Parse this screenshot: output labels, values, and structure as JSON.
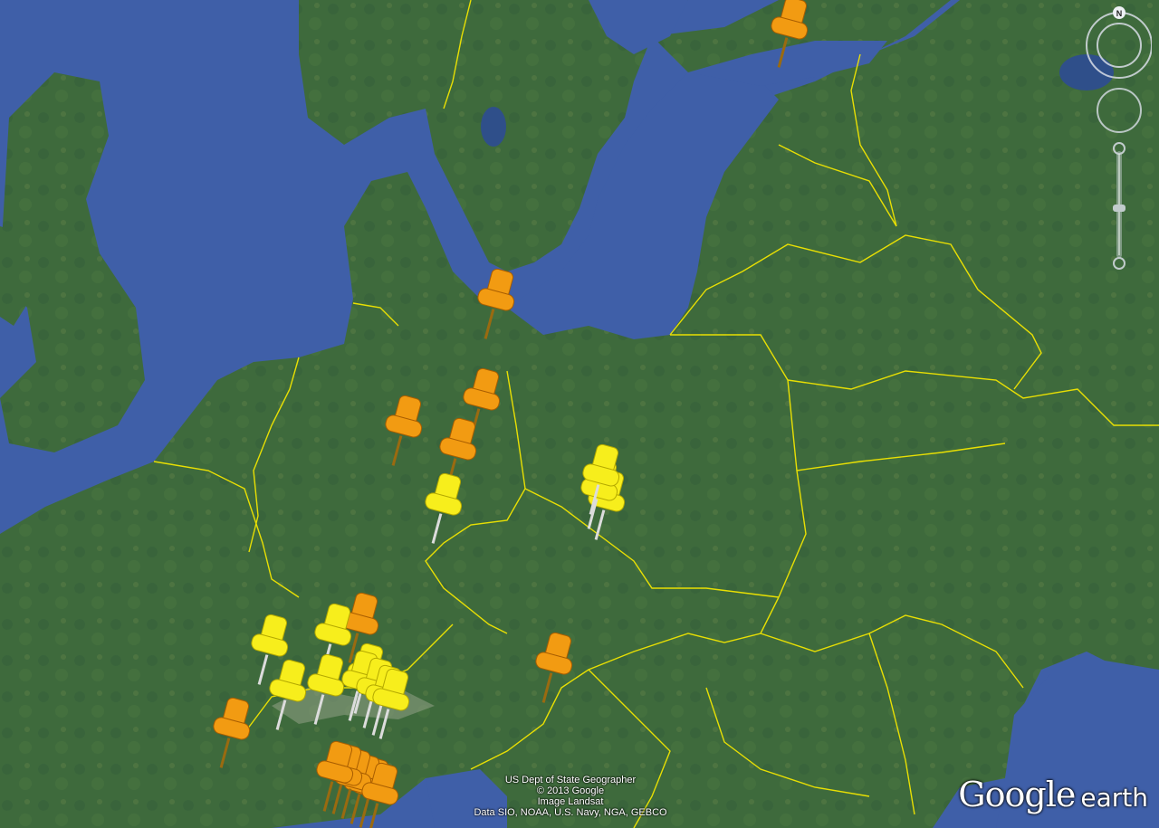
{
  "map": {
    "attribution_lines": [
      "US Dept of State Geographer",
      "© 2013 Google",
      "Image Landsat",
      "Data SIO, NOAA, U.S. Navy, NGA, GEBCO"
    ],
    "logo": {
      "google": "Google",
      "earth": "earth"
    },
    "compass_label": "N",
    "colors": {
      "water": "#3f5fa8",
      "land": "#3f6a3b",
      "border": "#f2e600",
      "pin_orange": "#f29b12",
      "pin_yellow": "#f7ee1c"
    },
    "pins_orange_count": 14,
    "pins_yellow_count": 13
  }
}
